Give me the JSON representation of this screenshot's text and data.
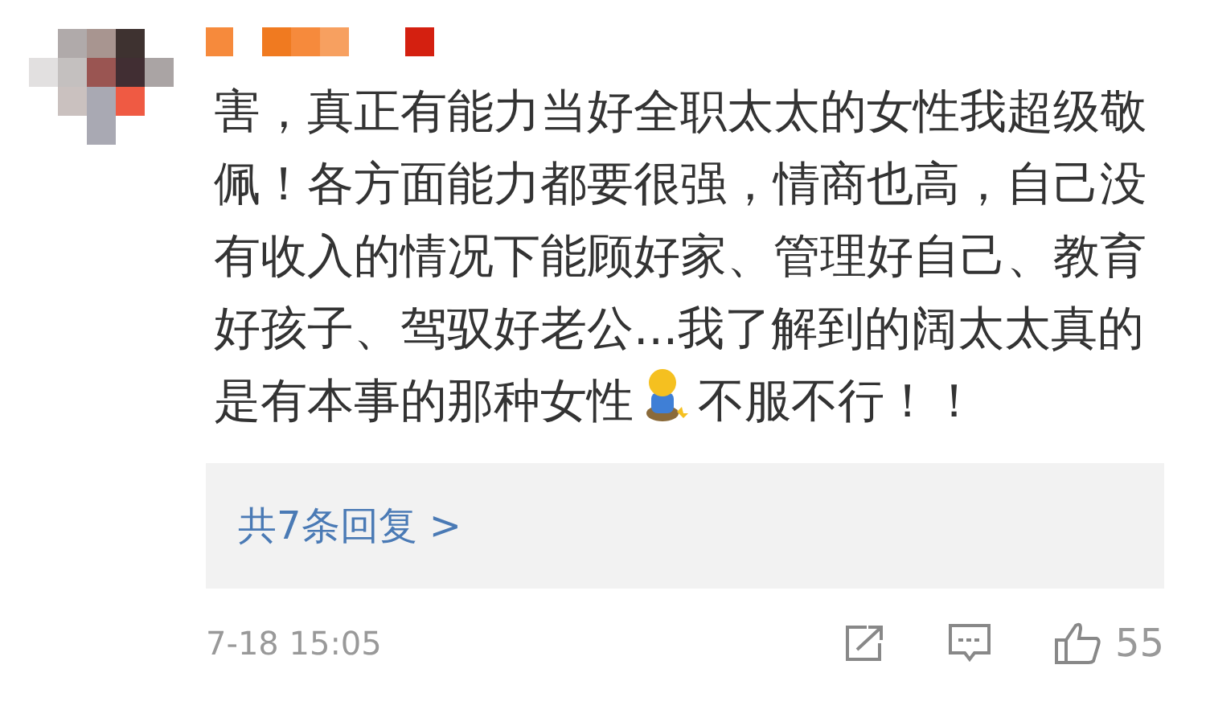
{
  "comment": {
    "text": "害，真正有能力当好全职太太的女性我超级敬佩！各方面能力都要很强，情商也高，自己没有收入的情况下能顾好家、管理好自己、教育好孩子、驾驭好老公...我了解到的阔太太真的是有本事的那种女性",
    "text_after_emoji": "不服不行！！"
  },
  "replies": {
    "label": "共7条回复 >"
  },
  "footer": {
    "time": "7-18 15:05",
    "likes": "55"
  }
}
